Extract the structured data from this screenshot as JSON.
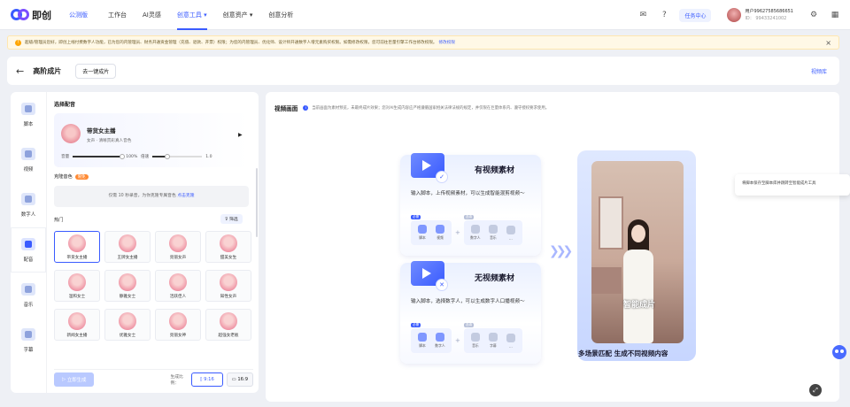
{
  "nav": {
    "logo_text": "即创",
    "edition": "公测版",
    "items": [
      {
        "label": "工作台"
      },
      {
        "label": "AI灵感"
      },
      {
        "label": "创意工具 ▾"
      },
      {
        "label": "创意资产 ▾"
      },
      {
        "label": "创意分析"
      }
    ],
    "active_index": 2,
    "task_center": "任务中心",
    "user_name": "用户99627585686651",
    "user_id": "ID： 99433241002"
  },
  "notice": {
    "text": "超级/管理员您好，即创上线付费数字人功能，已为您的内管理员、财务开通资金管理（充值、退款、开票）权限；为您的内管理员、优化师、设计师开通数字人增元素购买权限。如需修改权限，您可前往巨量引擎工作台修改权限。",
    "link": "修改权限",
    "close": "×"
  },
  "header": {
    "back": "←",
    "title": "高阶成片",
    "oneclick": "去一键成片",
    "video_library": "视频库"
  },
  "sidebar": {
    "items": [
      {
        "label": "脚本"
      },
      {
        "label": "视频"
      },
      {
        "label": "数字人"
      },
      {
        "label": "配音"
      },
      {
        "label": "音乐"
      },
      {
        "label": "字幕"
      }
    ],
    "active_index": 3
  },
  "voice": {
    "section_title": "选择配音",
    "card_name": "带货女主播",
    "card_desc": "女声 · 清晰贯彩真人音色",
    "volume_label": "音量",
    "volume_value": "100%",
    "speed_label": "倍速",
    "speed_value": "1.0",
    "volume_level": 1.0,
    "speed_level": 0.3,
    "clone_title": "克隆音色",
    "clone_badge": "限免",
    "clone_text": "仅需 10 秒录音，为你克隆专属音色",
    "clone_link": "点击克隆",
    "hot_label": "热门",
    "filter_label": "筛选",
    "voices": [
      {
        "label": "带货女主播"
      },
      {
        "label": "王牌女主播"
      },
      {
        "label": "亮丽女声"
      },
      {
        "label": "甜美女生"
      },
      {
        "label": "温和女士"
      },
      {
        "label": "静雅女士"
      },
      {
        "label": "活跃佳人"
      },
      {
        "label": "知性女声"
      },
      {
        "label": "新闻女主播"
      },
      {
        "label": "优雅女士"
      },
      {
        "label": "亮丽女神"
      },
      {
        "label": "超强女老板"
      }
    ],
    "selected_index": 0,
    "generate": "立即生成",
    "ratio_label": "生成比例：",
    "ratio_916": "9:16",
    "ratio_169": "16:9"
  },
  "main": {
    "title": "视频画面",
    "note": "当前画面为素材预览，未最终成片效果；您对AI生成内容应严格遵循国家相关法律法规的规定，并仅限在巨量体系内、遵守授权要求使用。",
    "card1_title": "有视频素材",
    "card1_desc": "输入脚本，上传视频素材，可以生成智能混剪视频～",
    "card1_tag": "必需",
    "card1_tag2": "选填",
    "card1_chips_req": [
      {
        "label": "脚本"
      },
      {
        "label": "视频"
      }
    ],
    "card1_chips_opt": [
      {
        "label": "数字人"
      },
      {
        "label": "音乐"
      },
      {
        "label": "…"
      }
    ],
    "card2_title": "无视频素材",
    "card2_desc": "输入脚本，选择数字人，可以生成数字人口播视频～",
    "card2_tag": "必需",
    "card2_tag2": "选填",
    "card2_chips_req": [
      {
        "label": "脚本"
      },
      {
        "label": "数字人"
      }
    ],
    "card2_chips_opt": [
      {
        "label": "音乐"
      },
      {
        "label": "字幕"
      },
      {
        "label": "…"
      }
    ],
    "phone_caption": "智能成片",
    "caption": "多场景匹配 生成不同视频内容"
  },
  "tooltip": "将脚本保存至脚本库并跳转至智能成片工具",
  "colors": {
    "accent": "#3a5bff",
    "notice_bg": "#fff8e6"
  }
}
